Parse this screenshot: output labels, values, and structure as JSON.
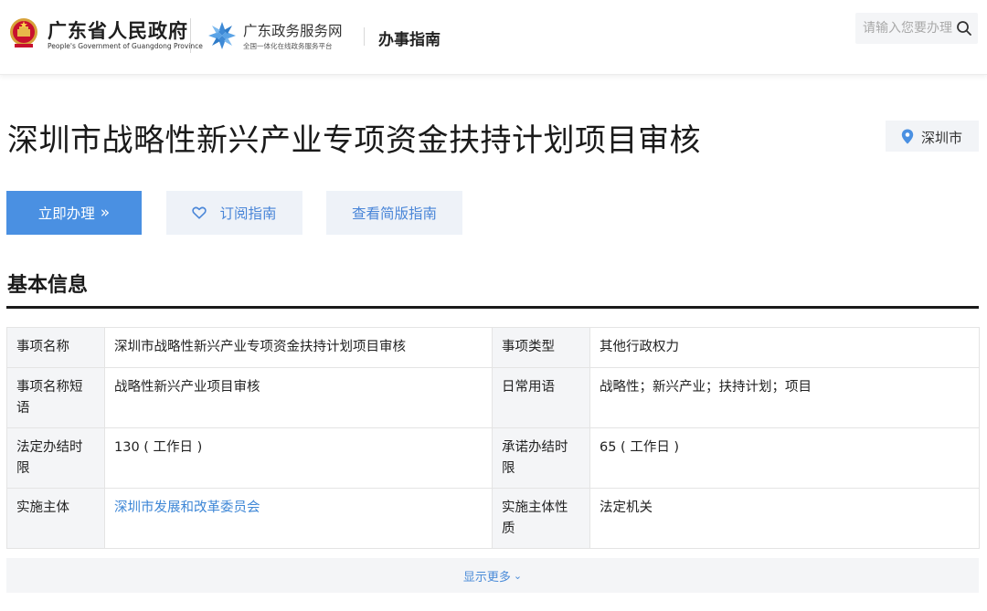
{
  "header": {
    "gov_name": "广东省人民政府",
    "gov_name_en": "People's Government of Guangdong Province",
    "service_name": "广东政务服务网",
    "service_sub": "全国一体化在线政务服务平台",
    "section": "办事指南",
    "search_placeholder": "请输入您要办理"
  },
  "page": {
    "title": "深圳市战略性新兴产业专项资金扶持计划项目审核",
    "location": "深圳市"
  },
  "actions": {
    "apply": "立即办理",
    "subscribe": "订阅指南",
    "simple": "查看简版指南"
  },
  "basic_info": {
    "heading": "基本信息",
    "rows": [
      {
        "label1": "事项名称",
        "value1": "深圳市战略性新兴产业专项资金扶持计划项目审核",
        "label2": "事项类型",
        "value2": "其他行政权力"
      },
      {
        "label1": "事项名称短语",
        "value1": "战略性新兴产业项目审核",
        "label2": "日常用语",
        "value2": "战略性；新兴产业；扶持计划；项目"
      },
      {
        "label1": "法定办结时限",
        "value1": "130 ( 工作日 )",
        "label2": "承诺办结时限",
        "value2": "65 ( 工作日 )"
      },
      {
        "label1": "实施主体",
        "value1": "深圳市发展和改革委员会",
        "label2": "实施主体性质",
        "value2": "法定机关"
      }
    ],
    "show_more": "显示更多"
  },
  "colors": {
    "primary": "#4a90e2",
    "link": "#3d86d6",
    "light_bg": "#eef2f8",
    "label_bg": "#f4f5f7"
  },
  "icons": {
    "emblem": "national-emblem-icon",
    "service_logo": "gd-service-logo-icon",
    "search": "search-icon",
    "location": "location-pin-icon",
    "apply_arrow": "double-chevron-right-icon",
    "subscribe": "heart-icon",
    "more": "chevron-down-icon"
  }
}
